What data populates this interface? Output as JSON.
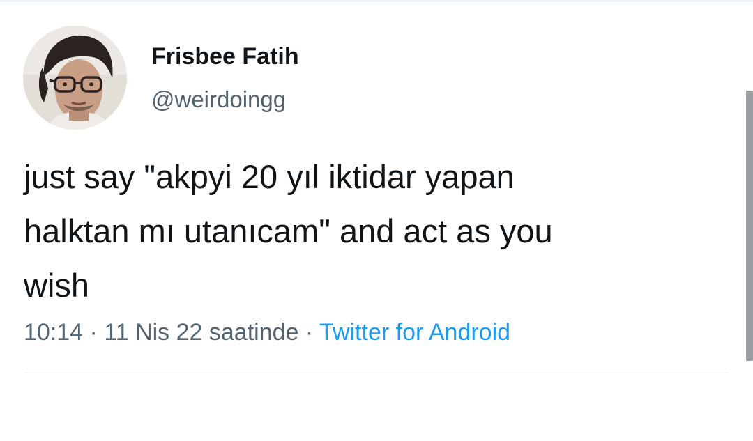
{
  "tweet": {
    "author": {
      "display_name": "Frisbee Fatih",
      "handle": "@weirdoingg"
    },
    "text_lines": [
      "just say \"akpyi 20 yıl iktidar yapan",
      "halktan mı utanıcam\" and act as you",
      "wish"
    ],
    "time": "10:14",
    "separator": "·",
    "date": "11 Nis 22 saatinde",
    "source": "Twitter for Android"
  },
  "icons": {
    "avatar": "profile-photo"
  },
  "colors": {
    "text_primary": "#0f1419",
    "text_secondary": "#536471",
    "link": "#1d9bf0",
    "divider": "#d8e3e8"
  }
}
